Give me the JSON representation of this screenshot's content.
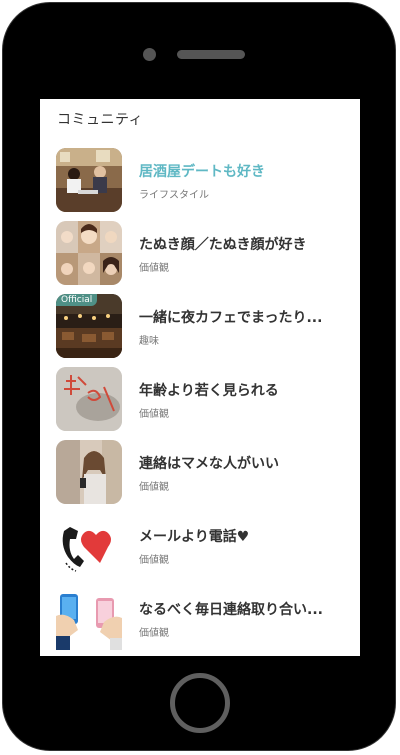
{
  "screen": {
    "title": "コミュニティ"
  },
  "communities": [
    {
      "title": "居酒屋デートも好き",
      "category": "ライフスタイル",
      "highlighted": true,
      "thumb": "izakaya-date-photo"
    },
    {
      "title": "たぬき顔／たぬき顔が好き",
      "category": "価値観",
      "thumb": "faces-collage-photo"
    },
    {
      "title": "一緒に夜カフェでまったり...",
      "category": "趣味",
      "badge": "Official",
      "thumb": "night-cafe-photo"
    },
    {
      "title": "年齢より若く見られる",
      "category": "価値観",
      "thumb": "young-handwriting-photo"
    },
    {
      "title": "連絡はマメな人がいい",
      "category": "価値観",
      "thumb": "woman-phone-photo"
    },
    {
      "title": "メールより電話♥",
      "category": "価値観",
      "thumb": "phone-heart-icon"
    },
    {
      "title": "なるべく毎日連絡取り合い...",
      "category": "価値観",
      "thumb": "hands-smartphones-icon"
    }
  ],
  "colors": {
    "accent": "#5fb8c4",
    "text": "#333333",
    "subtext": "#777777",
    "frame": "#000000"
  }
}
